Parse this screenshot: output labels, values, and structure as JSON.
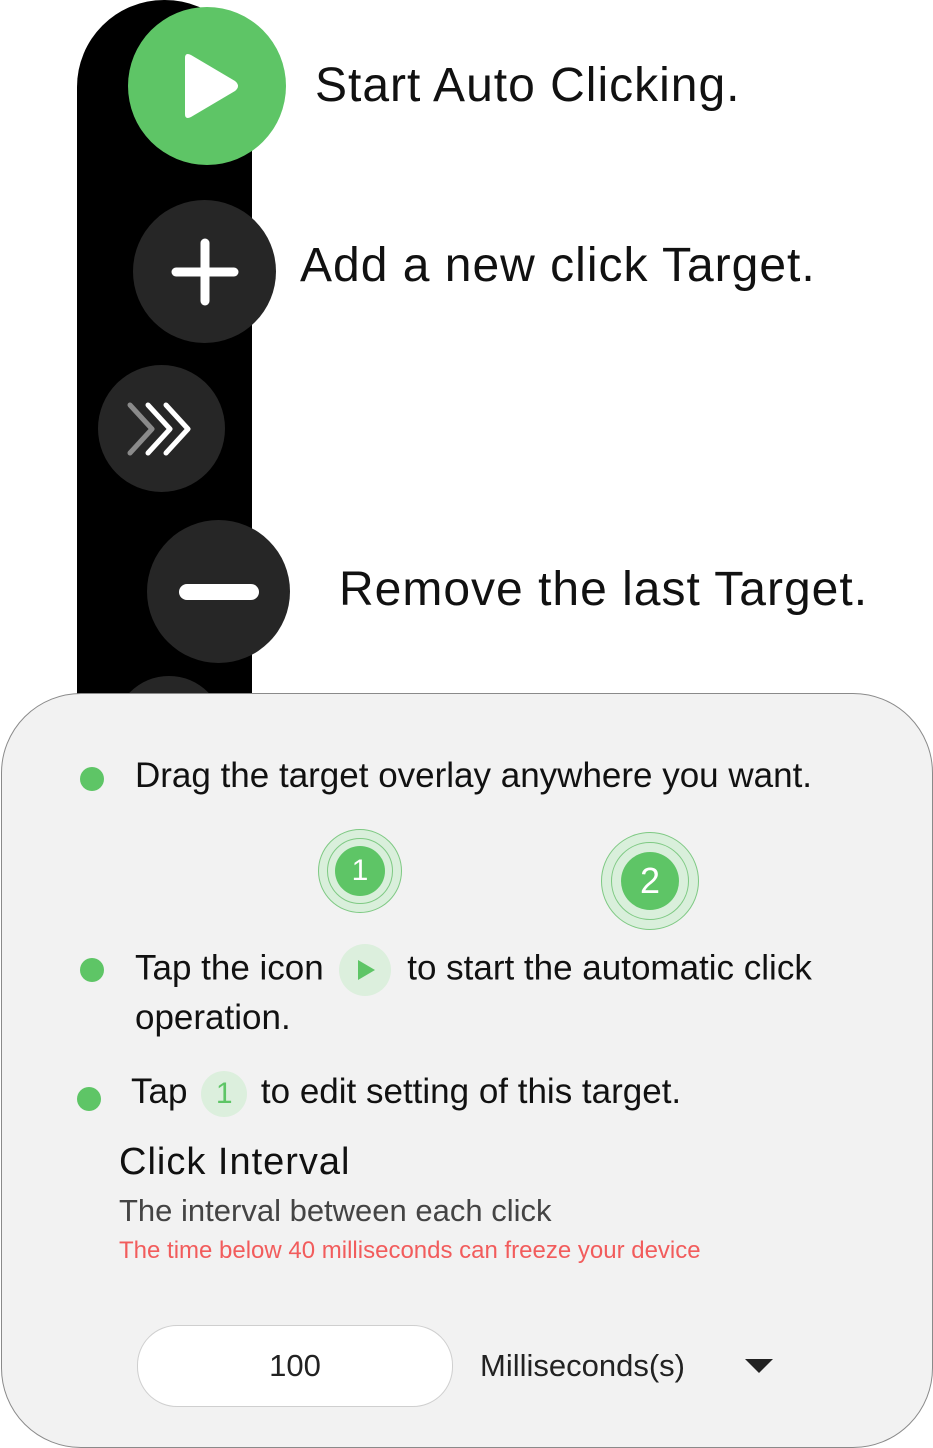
{
  "toolbar": {
    "start_label": "Start Auto Clicking.",
    "add_label": "Add a new click Target.",
    "remove_label": "Remove the last Target."
  },
  "instructions": {
    "drag": "Drag the target overlay anywhere you want.",
    "tap_icon_before": "Tap the icon",
    "tap_icon_after": "to start the automatic click operation.",
    "tap_target_before": "Tap",
    "tap_target_number": "1",
    "tap_target_after": "to edit setting of this target."
  },
  "targets": [
    {
      "label": "1"
    },
    {
      "label": "2"
    }
  ],
  "click_interval": {
    "title": "Click Interval",
    "description": "The interval between each click",
    "warning": "The time below 40 milliseconds can freeze your device",
    "value": "100",
    "unit": "Milliseconds(s)"
  },
  "colors": {
    "accent_green": "#5ec566",
    "fab_dark": "#262626",
    "warning_red": "#f25c5c",
    "panel_bg": "#f2f2f2"
  }
}
